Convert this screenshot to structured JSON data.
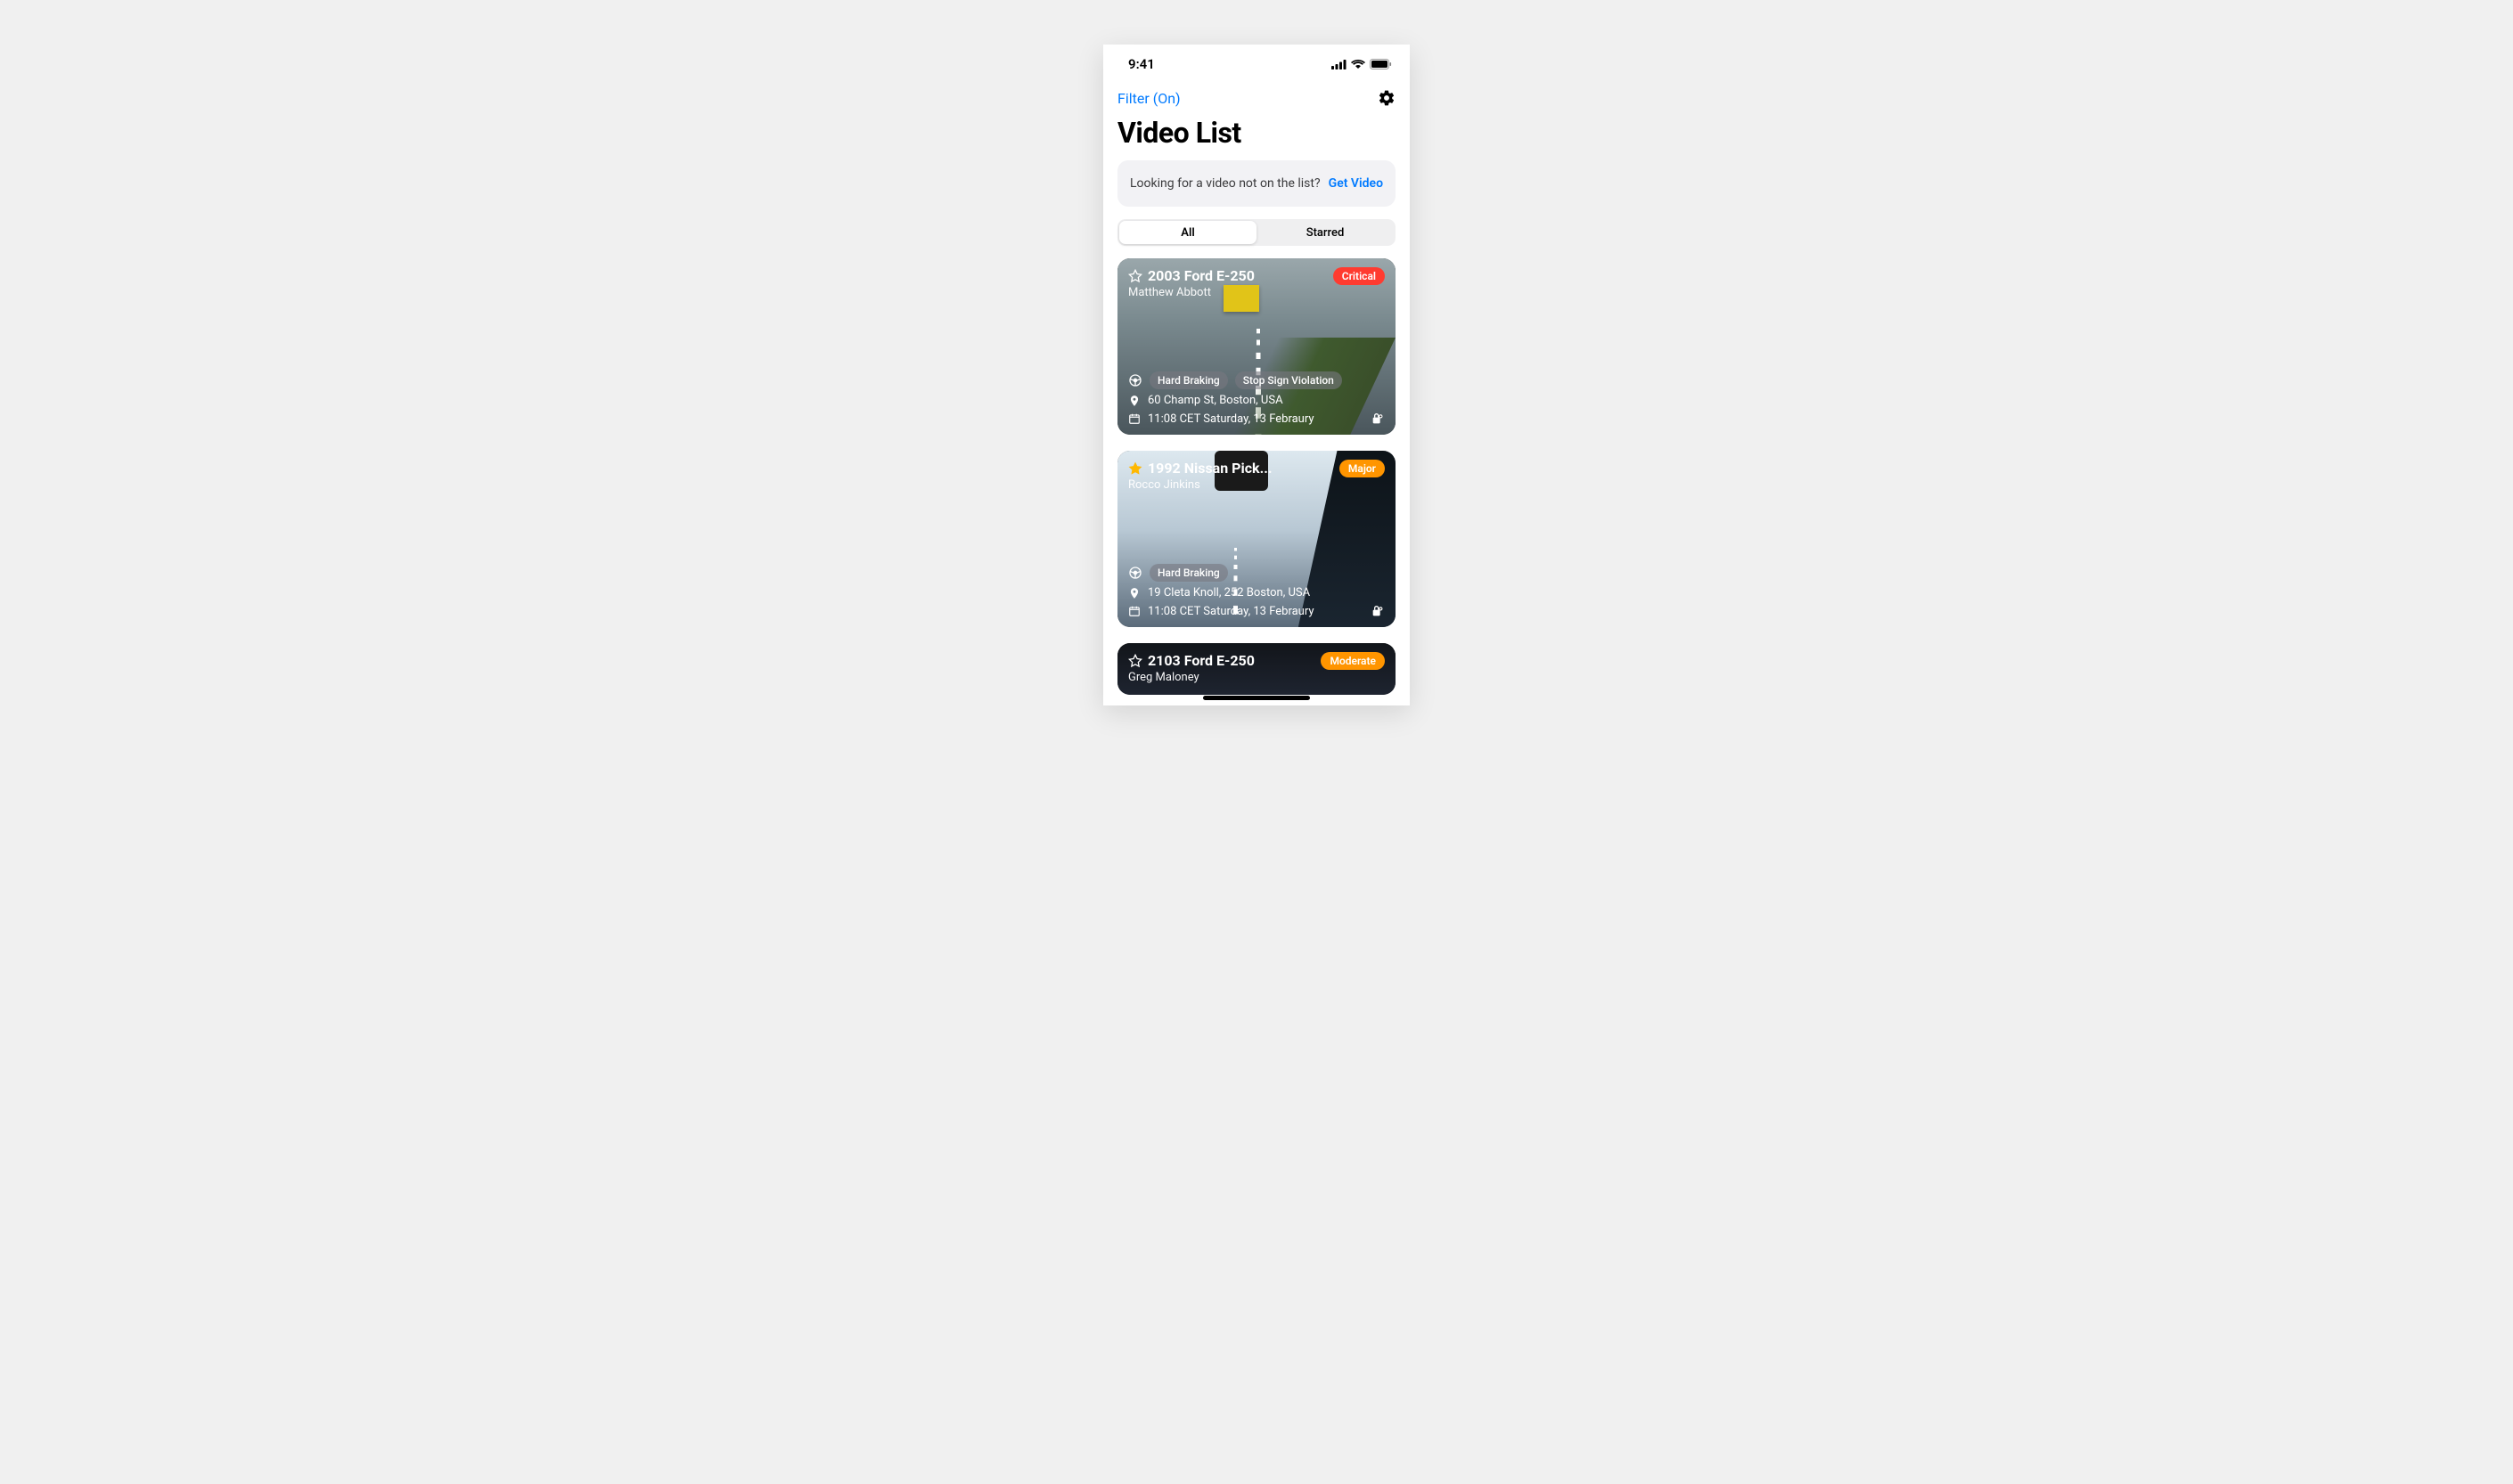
{
  "statusBar": {
    "time": "9:41"
  },
  "header": {
    "filterLabel": "Filter (On)",
    "title": "Video List"
  },
  "banner": {
    "text": "Looking for a video not on the list?",
    "link": "Get Video"
  },
  "segmented": {
    "tabs": [
      "All",
      "Starred"
    ],
    "active": 0
  },
  "severityColors": {
    "Critical": "#ff3b30",
    "Major": "#ff9500",
    "Moderate": "#ff9500"
  },
  "videos": [
    {
      "starred": false,
      "title": "2003 Ford E-250",
      "driver": "Matthew Abbott",
      "severity": "Critical",
      "tags": [
        "Hard Braking",
        "Stop Sign Violation"
      ],
      "location": "60 Champ St, Boston, USA",
      "datetime": "11:08 CET Saturday, 13 Febraury"
    },
    {
      "starred": true,
      "title": "1992 Nissan Pick...",
      "driver": "Rocco Jinkins",
      "severity": "Major",
      "tags": [
        "Hard Braking"
      ],
      "location": "19 Cleta Knoll, 252 Boston, USA",
      "datetime": "11:08 CET Saturday, 13 Febraury"
    },
    {
      "starred": false,
      "title": "2103 Ford E-250",
      "driver": "Greg Maloney",
      "severity": "Moderate",
      "tags": [],
      "location": "",
      "datetime": ""
    }
  ]
}
